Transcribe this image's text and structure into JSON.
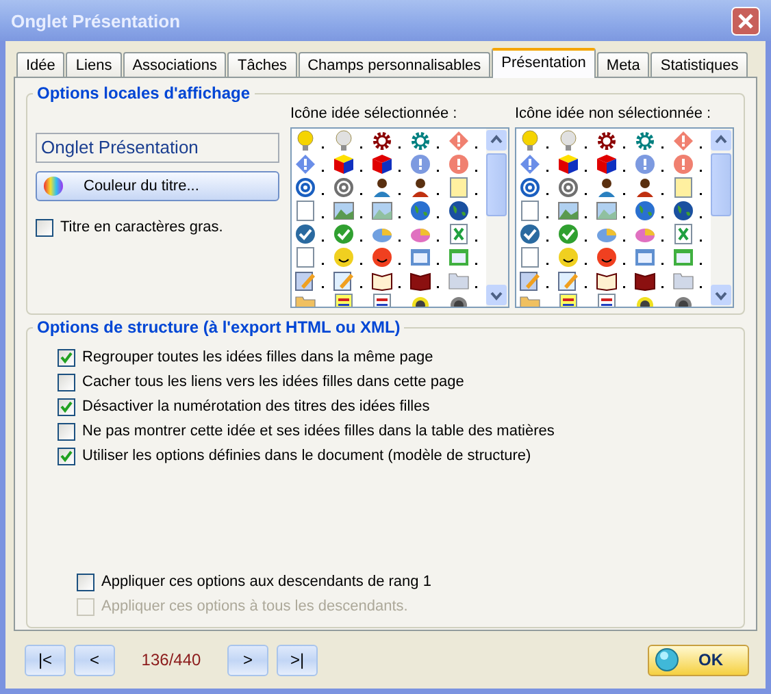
{
  "window": {
    "title": "Onglet Présentation"
  },
  "tabs": [
    {
      "label": "Idée",
      "selected": false
    },
    {
      "label": "Liens",
      "selected": false
    },
    {
      "label": "Associations",
      "selected": false
    },
    {
      "label": "Tâches",
      "selected": false
    },
    {
      "label": "Champs personnalisables",
      "selected": false
    },
    {
      "label": "Présentation",
      "selected": true
    },
    {
      "label": "Meta",
      "selected": false
    },
    {
      "label": "Statistiques",
      "selected": false
    }
  ],
  "display_options": {
    "heading": "Options locales d'affichage",
    "title_field": {
      "value": "Onglet Présentation"
    },
    "color_button": "Couleur du titre...",
    "bold_title": {
      "label": "Titre en caractères gras.",
      "checked": false
    },
    "selected_icon_label": "Icône idée sélectionnée :",
    "unselected_icon_label": "Icône idée non sélectionnée :"
  },
  "structure_options": {
    "heading": "Options de structure (à l'export HTML ou XML)",
    "options": [
      {
        "label": "Regrouper toutes les idées filles dans la même page",
        "checked": true
      },
      {
        "label": "Cacher tous les liens vers les idées filles dans cette page",
        "checked": false
      },
      {
        "label": "Désactiver la numérotation des titres des idées filles",
        "checked": true
      },
      {
        "label": "Ne pas montrer cette idée et ses idées filles dans la table des matières",
        "checked": false
      },
      {
        "label": "Utiliser les options définies dans le document (modèle de structure)",
        "checked": true
      }
    ],
    "apply_options": [
      {
        "label": "Appliquer ces options aux descendants de rang 1",
        "checked": false,
        "disabled": false
      },
      {
        "label": "Appliquer ces options à tous les descendants.",
        "checked": false,
        "disabled": true
      }
    ]
  },
  "navigation": {
    "buttons": [
      "|<",
      "<",
      ">",
      ">|"
    ],
    "counter": "136/440"
  },
  "ok_button": "OK"
}
